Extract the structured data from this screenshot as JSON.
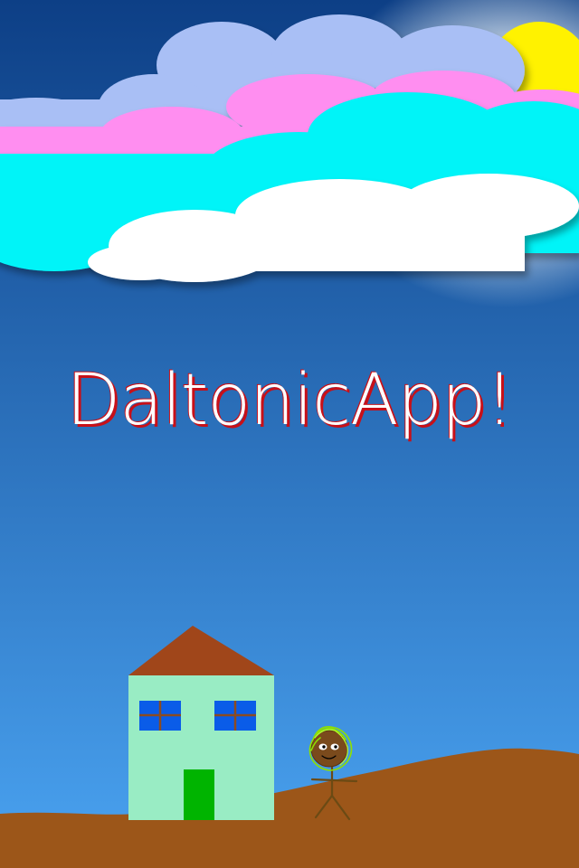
{
  "app": {
    "title": "DaltonicApp!"
  },
  "scene": {
    "elements": [
      "sky",
      "sun",
      "clouds",
      "house",
      "stick-figure",
      "ground"
    ]
  },
  "colors": {
    "sky_top": "#0d3f86",
    "sky_bottom": "#4aa3f1",
    "sun": "#fff200",
    "cloud_lavender": "#a9bff5",
    "cloud_pink": "#ff8ef0",
    "cloud_cyan": "#00f4f8",
    "cloud_white": "#ffffff",
    "house_wall": "#99ecc4",
    "house_roof": "#a0461a",
    "house_door": "#00b400",
    "house_window": "#0a5ce8",
    "window_frame": "#8b4b22",
    "ground": "#9c5619",
    "figure_head": "#7a4a1c",
    "figure_hair": "#8fe000",
    "title_text": "#ffffff",
    "title_shadow": "#c81018"
  }
}
